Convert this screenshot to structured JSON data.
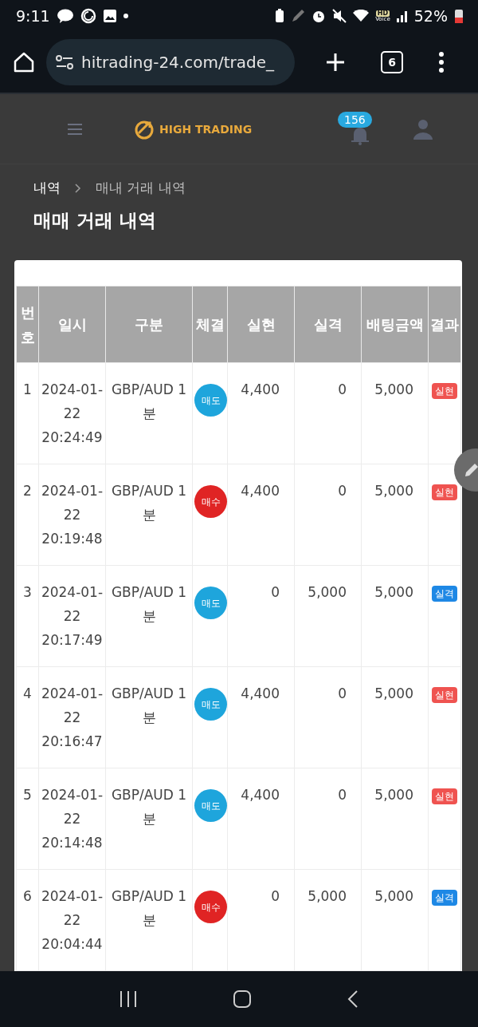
{
  "status_bar": {
    "time": "9:11",
    "hd": "HD",
    "voice": "Voice",
    "battery": "52%"
  },
  "browser": {
    "url": "hitrading-24.com/trade_",
    "tab_count": "6"
  },
  "header": {
    "logo": "HIGH TRADING",
    "notification_count": "156"
  },
  "breadcrumb": [
    "내역",
    "매내 거래 내역"
  ],
  "page_title": "매매 거래 내역",
  "table": {
    "columns": [
      "번호",
      "일시",
      "구분",
      "체결",
      "실현",
      "실격",
      "배팅금액",
      "결과"
    ],
    "rows": [
      {
        "no": "1",
        "date": "2024-01-22 20:24:49",
        "type": "GBP/AUD 1분",
        "trade": {
          "label": "매도",
          "kind": "sell"
        },
        "profit": "4,400",
        "loss": "0",
        "bet": "5,000",
        "result": {
          "label": "실현",
          "kind": "win"
        }
      },
      {
        "no": "2",
        "date": "2024-01-22 20:19:48",
        "type": "GBP/AUD 1분",
        "trade": {
          "label": "매수",
          "kind": "buy"
        },
        "profit": "4,400",
        "loss": "0",
        "bet": "5,000",
        "result": {
          "label": "실현",
          "kind": "win"
        }
      },
      {
        "no": "3",
        "date": "2024-01-22 20:17:49",
        "type": "GBP/AUD 1분",
        "trade": {
          "label": "매도",
          "kind": "sell"
        },
        "profit": "0",
        "loss": "5,000",
        "bet": "5,000",
        "result": {
          "label": "실격",
          "kind": "loss"
        }
      },
      {
        "no": "4",
        "date": "2024-01-22 20:16:47",
        "type": "GBP/AUD 1분",
        "trade": {
          "label": "매도",
          "kind": "sell"
        },
        "profit": "4,400",
        "loss": "0",
        "bet": "5,000",
        "result": {
          "label": "실현",
          "kind": "win"
        }
      },
      {
        "no": "5",
        "date": "2024-01-22 20:14:48",
        "type": "GBP/AUD 1분",
        "trade": {
          "label": "매도",
          "kind": "sell"
        },
        "profit": "4,400",
        "loss": "0",
        "bet": "5,000",
        "result": {
          "label": "실현",
          "kind": "win"
        }
      },
      {
        "no": "6",
        "date": "2024-01-22 20:04:44",
        "type": "GBP/AUD 1분",
        "trade": {
          "label": "매수",
          "kind": "buy"
        },
        "profit": "0",
        "loss": "5,000",
        "bet": "5,000",
        "result": {
          "label": "실격",
          "kind": "loss"
        }
      }
    ]
  }
}
